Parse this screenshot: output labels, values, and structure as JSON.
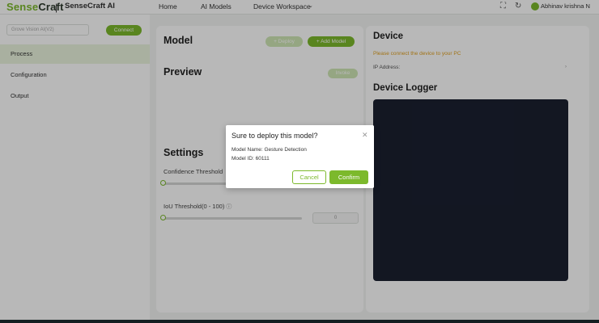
{
  "header": {
    "logo_sense": "Sense",
    "logo_craft": "Craft",
    "separator": "|",
    "app_name": "SenseCraft AI",
    "nav": {
      "home": "Home",
      "ai_models": "AI Models",
      "device_workspace": "Device Workspace"
    },
    "user_name": "Abhinav krishna N"
  },
  "sidebar": {
    "device_select_placeholder": "Grove Vision AI(V2)",
    "connect_label": "Connect",
    "items": {
      "process": "Process",
      "configuration": "Configuration",
      "output": "Output"
    }
  },
  "model_section": {
    "title": "Model",
    "deploy_label": "+ Deploy",
    "add_model_label": "+ Add Model"
  },
  "preview_section": {
    "title": "Preview",
    "invoke_label": "Invoke"
  },
  "settings_section": {
    "title": "Settings",
    "confidence_label": "Confidence Threshold",
    "iou_label": "IoU Threshold(0 - 100)",
    "iou_value": "0"
  },
  "device_section": {
    "title": "Device",
    "warning": "Please connect the device to your PC",
    "ip_label": "IP Address:"
  },
  "logger_section": {
    "title": "Device Logger"
  },
  "modal": {
    "title": "Sure to deploy this model?",
    "model_name_line": "Model Name: Gesture Detection",
    "model_id_line": "Model ID: 60111",
    "cancel_label": "Cancel",
    "confirm_label": "Confirm"
  },
  "colors": {
    "accent": "#7cb92c",
    "warning": "#e0a020",
    "logger_bg": "#1b2030"
  }
}
